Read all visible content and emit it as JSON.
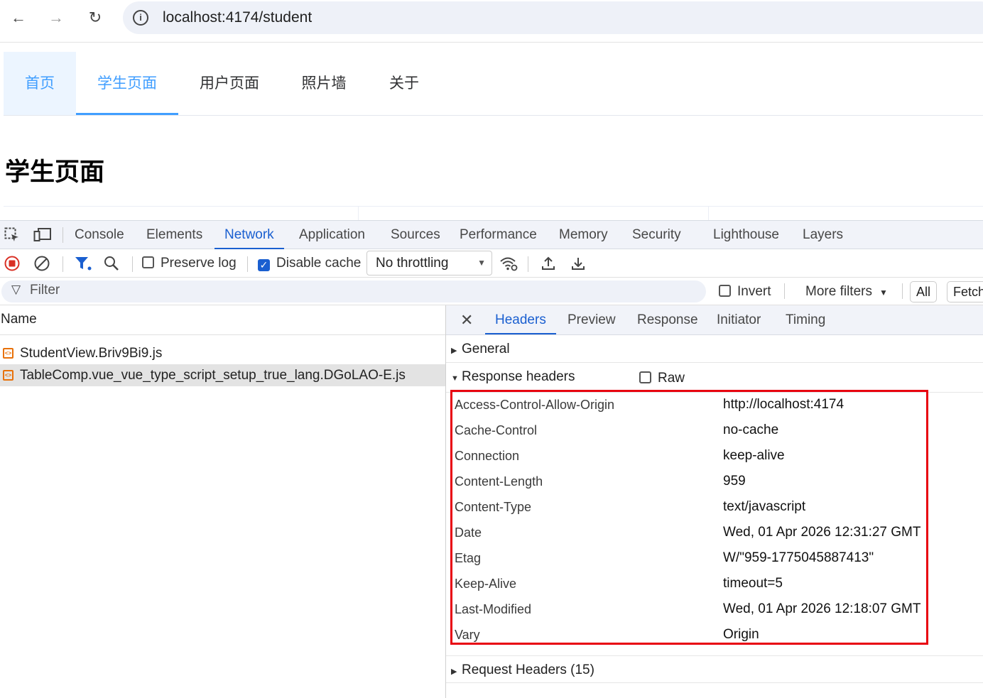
{
  "browser": {
    "url": "localhost:4174/student",
    "info_icon": "i"
  },
  "site": {
    "nav": [
      "首页",
      "学生页面",
      "用户页面",
      "照片墙",
      "关于"
    ],
    "page_title": "学生页面"
  },
  "devtools": {
    "tabs": [
      "Console",
      "Elements",
      "Network",
      "Application",
      "Sources",
      "Performance",
      "Memory",
      "Security",
      "Lighthouse",
      "Layers"
    ],
    "active_tab": "Network",
    "toolbar": {
      "preserve_log": "Preserve log",
      "preserve_log_checked": false,
      "disable_cache": "Disable cache",
      "disable_cache_checked": true,
      "throttling": "No throttling"
    },
    "filter": {
      "placeholder": "Filter",
      "invert": "Invert",
      "more_filters": "More filters",
      "all": "All",
      "fetch": "Fetch"
    },
    "name_header": "Name",
    "requests": [
      {
        "name": "StudentView.Briv9Bi9.js",
        "selected": false
      },
      {
        "name": "TableComp.vue_vue_type_script_setup_true_lang.DGoLAO-E.js",
        "selected": true
      }
    ],
    "detail": {
      "close": "✕",
      "tabs": [
        "Headers",
        "Preview",
        "Response",
        "Initiator",
        "Timing"
      ],
      "active_tab": "Headers",
      "general": "General",
      "response_headers": "Response headers",
      "raw": "Raw",
      "headers": [
        {
          "key": "Access-Control-Allow-Origin",
          "value": "http://localhost:4174"
        },
        {
          "key": "Cache-Control",
          "value": "no-cache"
        },
        {
          "key": "Connection",
          "value": "keep-alive"
        },
        {
          "key": "Content-Length",
          "value": "959"
        },
        {
          "key": "Content-Type",
          "value": "text/javascript"
        },
        {
          "key": "Date",
          "value": "Wed, 01 Apr 2026 12:31:27 GMT"
        },
        {
          "key": "Etag",
          "value": "W/\"959-1775045887413\""
        },
        {
          "key": "Keep-Alive",
          "value": "timeout=5"
        },
        {
          "key": "Last-Modified",
          "value": "Wed, 01 Apr 2026 12:18:07 GMT"
        },
        {
          "key": "Vary",
          "value": "Origin"
        }
      ],
      "request_headers": "Request Headers (15)"
    },
    "colors": {
      "accent": "#1a5fd0",
      "highlight_box": "#e8000f",
      "site_accent": "#409eff"
    }
  }
}
